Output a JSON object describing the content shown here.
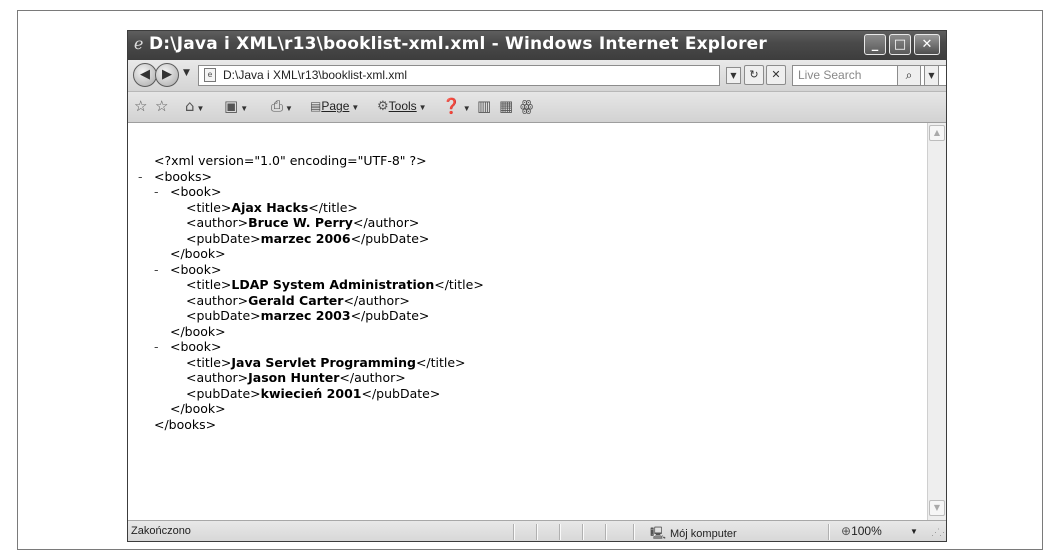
{
  "window": {
    "title": "D:\\Java i XML\\r13\\booklist-xml.xml - Windows Internet Explorer",
    "minimize_glyph": "_",
    "maximize_glyph": "□",
    "close_glyph": "✕"
  },
  "address_bar": {
    "url": "D:\\Java i XML\\r13\\booklist-xml.xml"
  },
  "search": {
    "placeholder": "Live Search"
  },
  "command_bar": {
    "page_prefix": "",
    "page_label": "Page",
    "tools_label": "Tools"
  },
  "xml": {
    "declaration": "<?xml version=\"1.0\" encoding=\"UTF-8\" ?>",
    "tree_toggle": "-",
    "root_open": "<books>",
    "root_close": "</books>",
    "book_open": "<book>",
    "book_close": "</book>",
    "books": [
      {
        "title_open": "<title>",
        "title": "Ajax Hacks",
        "title_close": "</title>",
        "author_open": "<author>",
        "author": "Bruce W. Perry",
        "author_close": "</author>",
        "pubdate_open": "<pubDate>",
        "pubdate": "marzec 2006",
        "pubdate_close": "</pubDate>"
      },
      {
        "title_open": "<title>",
        "title": "LDAP System Administration",
        "title_close": "</title>",
        "author_open": "<author>",
        "author": "Gerald Carter",
        "author_close": "</author>",
        "pubdate_open": "<pubDate>",
        "pubdate": "marzec 2003",
        "pubdate_close": "</pubDate>"
      },
      {
        "title_open": "<title>",
        "title": "Java Servlet Programming",
        "title_close": "</title>",
        "author_open": "<author>",
        "author": "Jason Hunter",
        "author_close": "</author>",
        "pubdate_open": "<pubDate>",
        "pubdate": "kwiecień 2001",
        "pubdate_close": "</pubDate>"
      }
    ]
  },
  "status_bar": {
    "status": "Zakończono",
    "zone": "Mój komputer",
    "zoom": "100%"
  },
  "icons": {
    "ie_logo": "ie-logo-icon",
    "back": "back-arrow-icon",
    "forward": "forward-arrow-icon",
    "page": "page-icon",
    "refresh": "refresh-icon",
    "stop": "stop-icon",
    "search": "magnifier-icon",
    "favorites": "favorites-star-icon",
    "add_favorite": "add-favorite-icon",
    "home": "home-icon",
    "feeds": "feeds-icon",
    "print": "printer-icon",
    "tools": "gear-icon",
    "help": "help-icon",
    "research": "research-icon",
    "messenger": "messenger-icon",
    "computer": "computer-icon",
    "zoom": "zoom-icon"
  }
}
